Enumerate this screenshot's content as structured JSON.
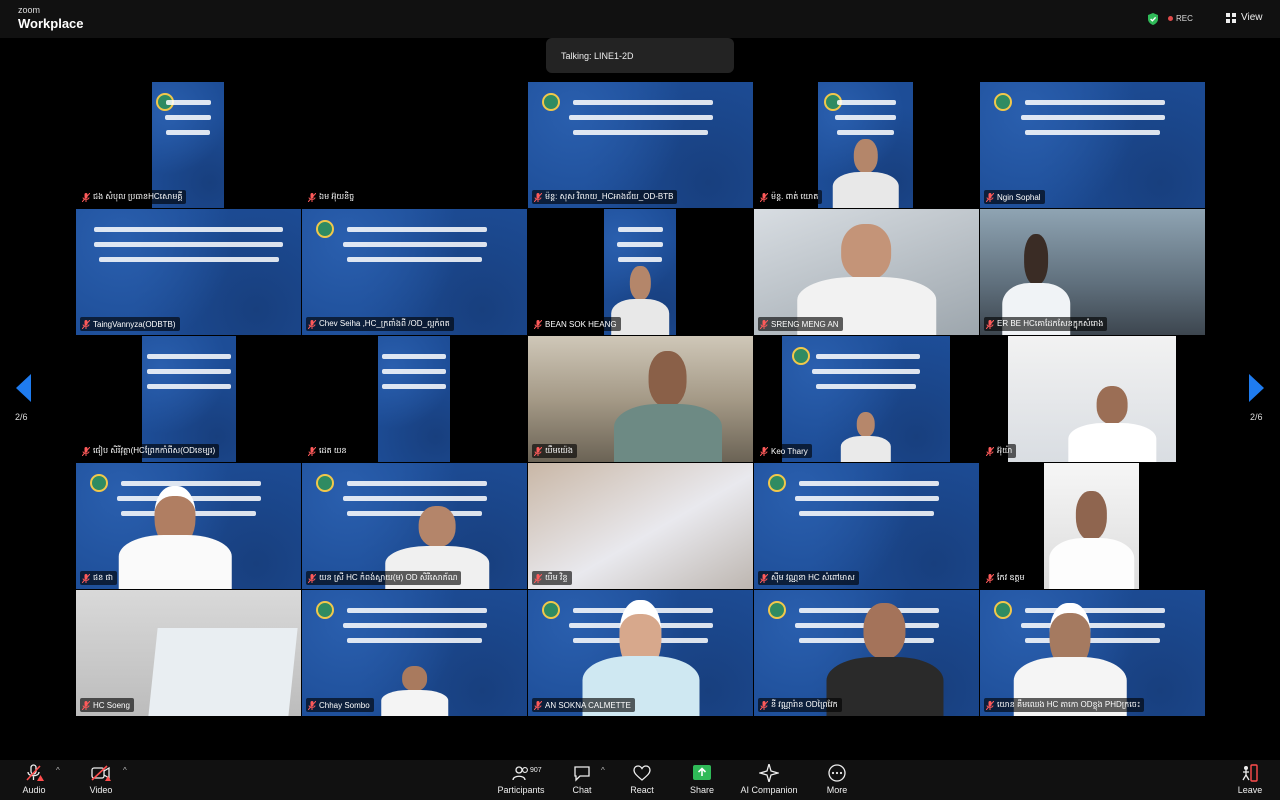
{
  "app": {
    "brand_small": "zoom",
    "brand_large": "Workplace"
  },
  "header": {
    "rec_label": "REC",
    "view_label": "View"
  },
  "talking": "Talking: LINE1-2D",
  "pages": {
    "left": "2/6",
    "right": "2/6"
  },
  "colors": {
    "slide_blue": "#1d4d97",
    "accent_red": "#e04a4a",
    "share_green": "#2fba58"
  },
  "participants": [
    {
      "name": "ជង សំបុល ប្រធានHCសោមគ្គី"
    },
    {
      "name": "ឯម អ៊ុយនិច្ច"
    },
    {
      "name": "ម៉ន្ត: សុស វិលាយ_HCអាងជ័យ_OD-BTB"
    },
    {
      "name": "ម៉ន្ត. ពាត់ យោត"
    },
    {
      "name": "Ngin Sophal"
    },
    {
      "name": "TaingVannyza(ODBTB)"
    },
    {
      "name": "Chev Seiha ,HC_ក្រពាំងពី /OD_ល្អក់ពត"
    },
    {
      "name": "BEAN SOK HEANG"
    },
    {
      "name": "SRENG MENG AN"
    },
    {
      "name": "ER BE HCគោដែកសែនក្នុកសំរោង"
    },
    {
      "name": "ផៀប សិរីវុត្ថា(HCព្រែកកាំពីស(ODខេម្បរ)"
    },
    {
      "name": "ដេត យន"
    },
    {
      "name": "យឹមយ៉េង"
    },
    {
      "name": "Keo Thary"
    },
    {
      "name": "អ៊ុយ៉ា"
    },
    {
      "name": "ផន ផា"
    },
    {
      "name": "យន ស្រី HC កំពង់ស្លាយ(ម) OD សិរីសោភ័ណ"
    },
    {
      "name": "យឹម វិន្ទ"
    },
    {
      "name": "ស៊ីម វណ្ណនា HC សំពៅមាស"
    },
    {
      "name": "កែវ ឧត្តម"
    },
    {
      "name": "HC Soeng"
    },
    {
      "name": "Chhay Sombo"
    },
    {
      "name": "AN SOKNA CALMETTE"
    },
    {
      "name": "នី វណ្ណារ៉ាន ODព្រៃវែក"
    },
    {
      "name": "យោន គឹមឈេង HC តាកោ ODខ្លុង PHDក្រចេះ"
    }
  ],
  "toolbar": {
    "audio": "Audio",
    "video": "Video",
    "participants": "Participants",
    "participants_count": "907",
    "chat": "Chat",
    "react": "React",
    "share": "Share",
    "ai_companion": "AI Companion",
    "more": "More",
    "leave": "Leave"
  }
}
